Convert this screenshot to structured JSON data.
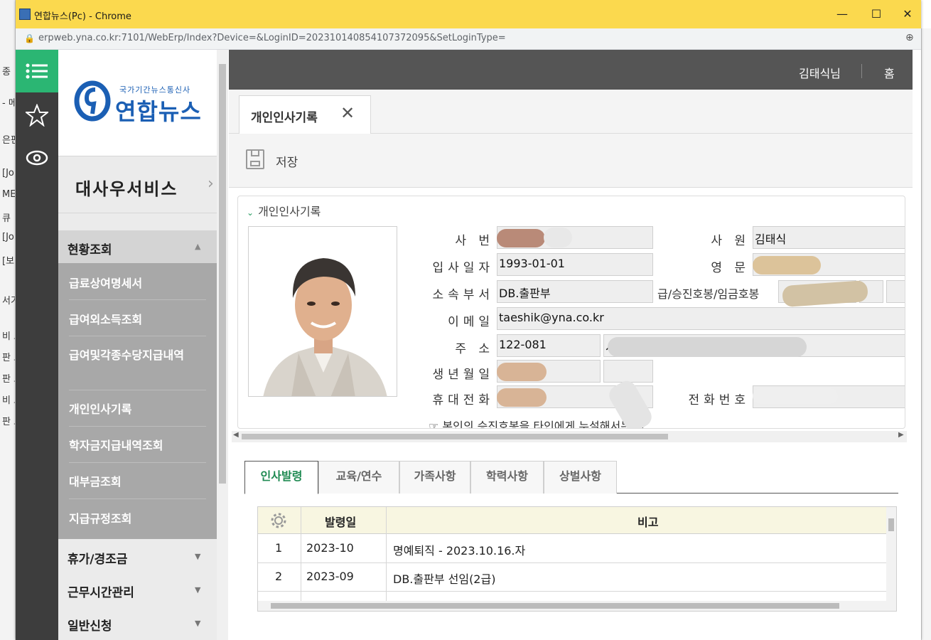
{
  "background": {
    "fragments": [
      "종",
      "- 메",
      "은판",
      "[Jo",
      "ME",
      "큐",
      "[Jo",
      "[보",
      "서기",
      "비 보",
      "판 보",
      "판 보",
      "비 보",
      "판 보"
    ]
  },
  "window": {
    "title": "연합뉴스(Pc) - Chrome",
    "url": "erpweb.yna.co.kr:7101/WebErp/Index?Device=&LoginID=20231014085410737209​5&SetLoginType=",
    "colors": {
      "titlebar": "#fbd94e",
      "accent": "#2bb673",
      "nav_dark": "#3d3d3d"
    }
  },
  "logo": {
    "subtitle": "국가기간뉴스통신사",
    "name": "연합뉴스"
  },
  "sidebar": {
    "section_title": "대사우서비스",
    "open_group": "현황조회",
    "items": [
      {
        "label": "급료상여명세서"
      },
      {
        "label": "급여외소득조회"
      },
      {
        "label": "급여및각종수당지급내역"
      },
      {
        "label": "개인인사기록"
      },
      {
        "label": "학자금지급내역조회"
      },
      {
        "label": "대부금조회"
      },
      {
        "label": "지급규정조회"
      }
    ],
    "closed_groups": [
      "휴가/경조금",
      "근무시간관리",
      "일반신청"
    ]
  },
  "topbar": {
    "user": "김태식님",
    "home": "홈"
  },
  "page_tab": {
    "label": "개인인사기록",
    "close": "✕"
  },
  "toolbar": {
    "save_label": "저장"
  },
  "panel": {
    "title": "개인인사기록",
    "fields": {
      "emp_no_label": "사 번",
      "emp_no_value": "",
      "name_label": "사 원",
      "name_value": "김태식",
      "join_label": "입사일자",
      "join_value": "1993-01-01",
      "eng_label": "영 문",
      "eng_value": "",
      "dept_label": "소속부서",
      "dept_value": "DB.출판부",
      "grade_label": "급/승진호봉/임금호봉",
      "email_label": "이메일",
      "email_value": "taeshik@yna.co.kr",
      "addr_label": "주 소",
      "zip_value": "122-081",
      "addr_value": "서",
      "birth_label": "생년월일",
      "mobile_label": "휴대전화",
      "phone_label": "전화번호",
      "notice": "☞ 본인의 승진호봉을 타인에게 누설해서는 안"
    }
  },
  "subtabs": [
    "인사발령",
    "교육/연수",
    "가족사항",
    "학력사항",
    "상벌사항"
  ],
  "grid": {
    "columns": [
      "발령일",
      "비고"
    ],
    "rows": [
      {
        "no": "1",
        "date": "2023-10",
        "note": "명예퇴직 - 2023.10.16.자"
      },
      {
        "no": "2",
        "date": "2023-09",
        "note": "DB.출판부 선임(2급)"
      }
    ]
  }
}
